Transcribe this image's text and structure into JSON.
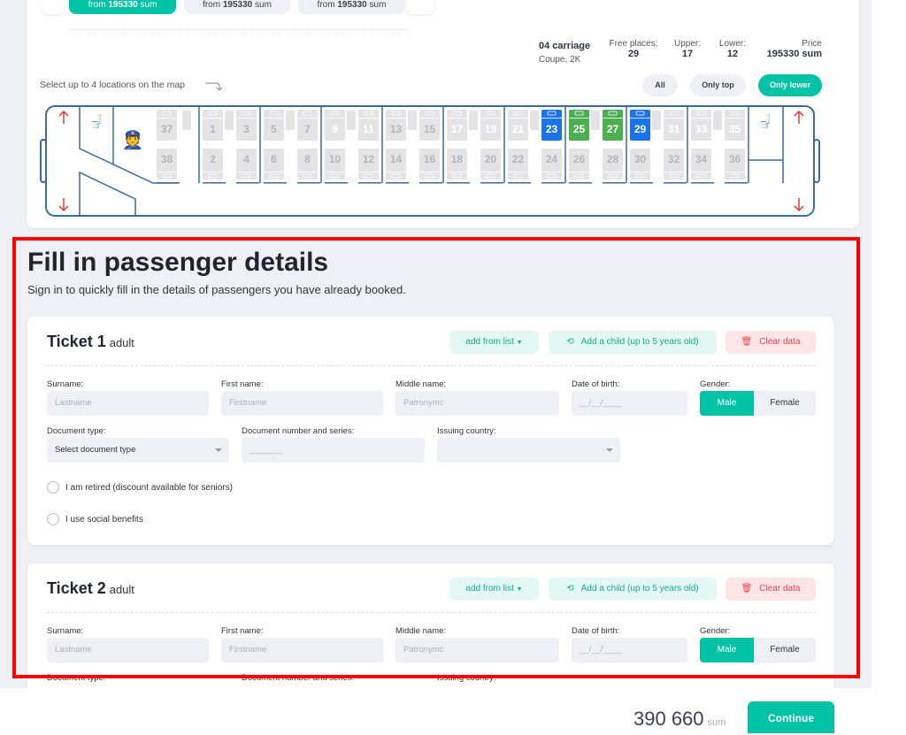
{
  "tabs": [
    {
      "prefix": "from",
      "price": "195330",
      "unit": "sum",
      "active": true
    },
    {
      "prefix": "from",
      "price": "195330",
      "unit": "sum",
      "active": false
    },
    {
      "prefix": "from",
      "price": "195330",
      "unit": "sum",
      "active": false
    }
  ],
  "carriage": {
    "name": "04 carriage",
    "type": "Coupe, 2K",
    "free_label": "Free places:",
    "free": "29",
    "upper_label": "Upper:",
    "upper": "17",
    "lower_label": "Lower:",
    "lower": "12",
    "price_label": "Price",
    "price": "195330 sum"
  },
  "map_hint": "Select up to 4 locations on the map",
  "filters": {
    "all": "All",
    "top": "Only top",
    "lower": "Only lower",
    "active": "lower"
  },
  "seats": {
    "top": [
      {
        "n": "37",
        "s": "taken"
      },
      {
        "n": "1",
        "s": "taken"
      },
      {
        "n": "3",
        "s": "taken"
      },
      {
        "n": "5",
        "s": "taken"
      },
      {
        "n": "7",
        "s": "taken"
      },
      {
        "n": "9",
        "s": "filtered"
      },
      {
        "n": "11",
        "s": "filtered"
      },
      {
        "n": "13",
        "s": "taken"
      },
      {
        "n": "15",
        "s": "taken"
      },
      {
        "n": "17",
        "s": "filtered"
      },
      {
        "n": "19",
        "s": "filtered"
      },
      {
        "n": "21",
        "s": "filtered"
      },
      {
        "n": "23",
        "s": "selected"
      },
      {
        "n": "25",
        "s": "available"
      },
      {
        "n": "27",
        "s": "available"
      },
      {
        "n": "29",
        "s": "selected"
      },
      {
        "n": "31",
        "s": "filtered"
      },
      {
        "n": "33",
        "s": "filtered"
      },
      {
        "n": "35",
        "s": "filtered"
      }
    ],
    "bottom": [
      "38",
      "2",
      "4",
      "6",
      "8",
      "10",
      "12",
      "14",
      "16",
      "18",
      "20",
      "22",
      "24",
      "26",
      "28",
      "30",
      "32",
      "34",
      "36"
    ]
  },
  "colors": {
    "accent": "#00c2a4",
    "selected": "#1a73e8",
    "available": "#4caf50",
    "danger": "#e0484b",
    "car_outline": "#3d6a9e"
  },
  "heading": "Fill in passenger details",
  "subheading": "Sign in to quickly fill in the details of passengers you have already booked.",
  "tickets": [
    {
      "title": "Ticket 1",
      "kind": "adult"
    },
    {
      "title": "Ticket 2",
      "kind": "adult"
    }
  ],
  "form": {
    "add_from_list": "add from list",
    "add_child": "Add a child (up to 5 years old)",
    "clear": "Clear data",
    "surname_label": "Surname:",
    "surname_ph": "Lastname",
    "first_label": "First name:",
    "first_ph": "Firstname",
    "middle_label": "Middle name:",
    "middle_ph": "Patronymc",
    "dob_label": "Date of birth:",
    "dob_ph": "__/__/____",
    "gender_label": "Gender:",
    "male": "Male",
    "female": "Female",
    "doctype_label": "Document type:",
    "doctype_value": "Select document type",
    "docnum_label": "Document number and series:",
    "docnum_ph": "_______",
    "country_label": "Issuing country:",
    "country_value": "",
    "retired": "I am retired (discount available for seniors)",
    "social": "I use social benefits"
  },
  "footer": {
    "total": "390 660",
    "unit": "sum",
    "continue": "Continue"
  }
}
